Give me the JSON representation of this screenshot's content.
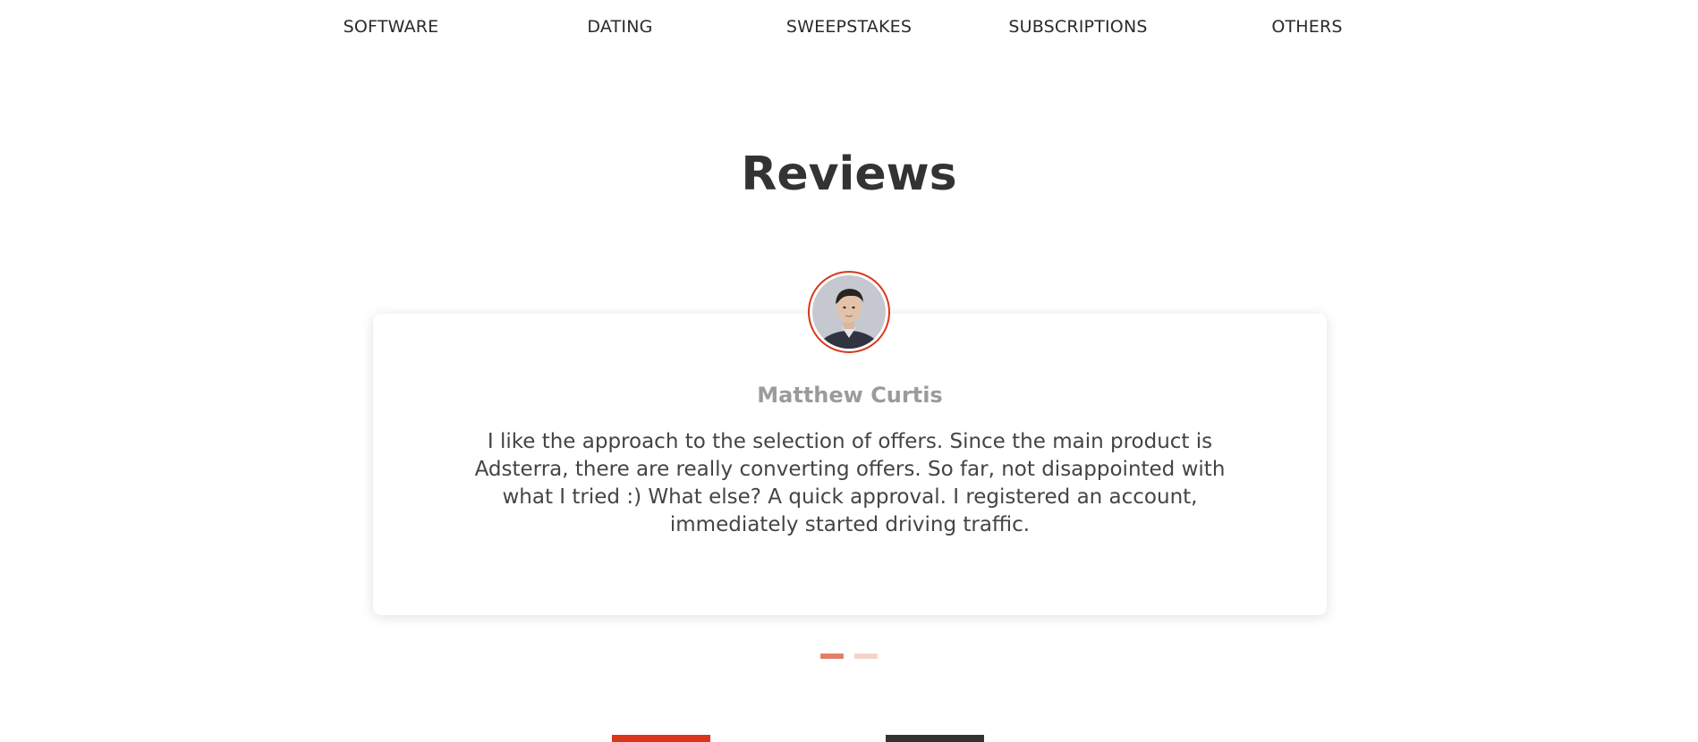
{
  "nav": {
    "items": [
      {
        "label": "SOFTWARE"
      },
      {
        "label": "DATING"
      },
      {
        "label": "SWEEPSTAKES"
      },
      {
        "label": "SUBSCRIPTIONS"
      },
      {
        "label": "OTHERS"
      }
    ]
  },
  "reviews": {
    "title": "Reviews",
    "current": {
      "name": "Matthew Curtis",
      "text": "I like the approach to the selection of offers. Since the main product is Adsterra, there are really converting offers. So far, not disappointed with what I tried :) What else? A quick approval. I registered an account, immediately started driving traffic.",
      "avatar_icon": "reviewer-photo"
    },
    "pager": {
      "total": 2,
      "active_index": 0
    }
  },
  "colors": {
    "accent": "#d9361b",
    "dot_active": "#e27e69",
    "dot_inactive": "#f6d3c9",
    "heading": "#333333",
    "name": "#9b9b9b"
  }
}
